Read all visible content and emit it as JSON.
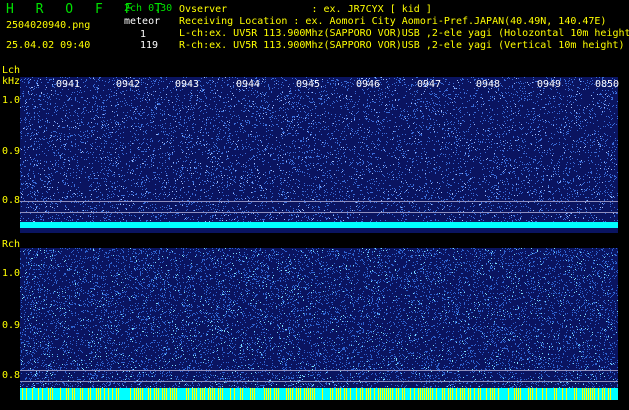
{
  "header": {
    "app_logo": "H R O F F T",
    "file_name": "2504020940.png",
    "timestamp": "25.04.02 09:40",
    "version": "2ch 0.30",
    "count_label": "meteor",
    "ch1_count": "1",
    "ch2_count": "119",
    "observer": "Ovserver              : ex. JR7CYX [ kid ]",
    "location": "Receiving Location : ex. Aomori City Aomori-Pref.JAPAN(40.49N, 140.47E)",
    "lch": "L-ch:ex. UV5R 113.900Mhz(SAPPORO VOR)USB ,2-ele yagi (Holozontal 10m height)",
    "rch": "R-ch:ex. UV5R 113.900Mhz(SAPPORO VOR)USB ,2-ele yagi (Vertical 10m height)"
  },
  "lch_panel": {
    "label": "Lch",
    "unit": "kHz",
    "y_ticks": [
      "1.0",
      "0.9",
      "0.8"
    ]
  },
  "rch_panel": {
    "label": "Rch",
    "y_ticks": [
      "1.0",
      "0.9",
      "0.8"
    ]
  },
  "time_labels": [
    "0941",
    "0942",
    "0943",
    "0944",
    "0945",
    "0946",
    "0947",
    "0948",
    "0949",
    "0850"
  ],
  "colors": {
    "background": "#0a1460",
    "noise": "#3a6cd8",
    "carrier": "#00ffff",
    "meteor": "#ffff00",
    "text": "#ffff00"
  }
}
